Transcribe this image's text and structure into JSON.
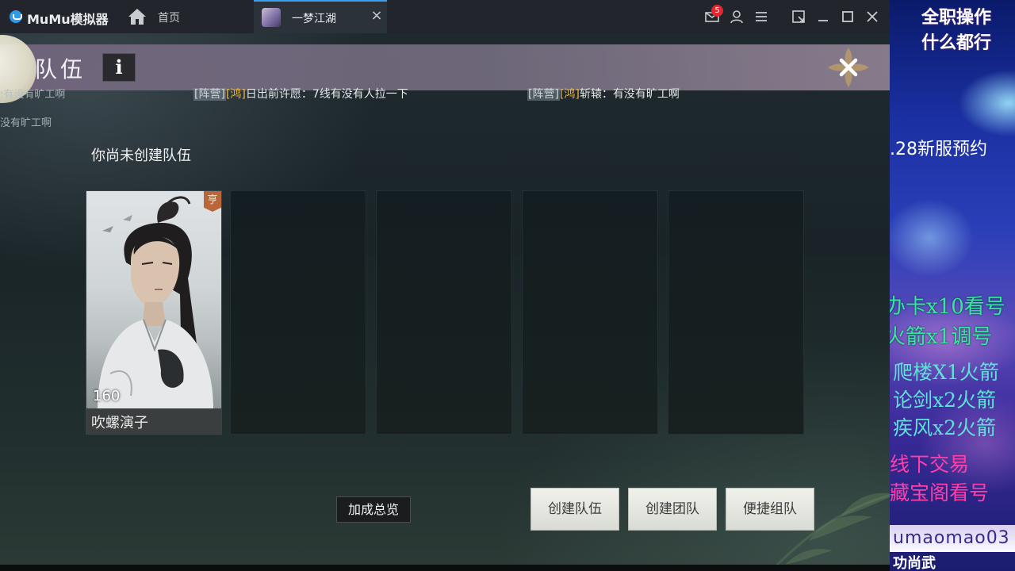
{
  "titlebar": {
    "app_name": "MuMu模拟器",
    "home_label": "首页",
    "active_tab": "一梦江湖",
    "mail_badge": "5"
  },
  "game": {
    "title": "队伍",
    "info_label": "i",
    "chat": [
      {
        "tag": "[阵营]",
        "guild": "[鸿]",
        "text": "日出前许愿：7线有没有人拉一下"
      },
      {
        "tag": "[阵营]",
        "guild": "[鸿]",
        "text": "斩辕：有没有旷工啊"
      }
    ],
    "chat_faded": [
      ":有没有旷工啊",
      "没有旷工啊"
    ],
    "no_team_text": "你尚未创建队伍",
    "member": {
      "level": "160",
      "name": "吹螺演子",
      "sect_badge": "亨"
    },
    "bonus_button": "加成总览",
    "buttons": {
      "create_team": "创建队伍",
      "create_group": "创建团队",
      "quick_match": "便捷组队"
    }
  },
  "overlay": {
    "header_line1": "全职操作",
    "header_line2": "什么都行",
    "promo": ".28新服预约",
    "lines_green": [
      "办卡x10看号",
      "火箭x1调号"
    ],
    "lines_teal": [
      "爬楼X1火箭",
      "论剑x2火箭",
      "疾风x2火箭"
    ],
    "lines_pink": [
      "线下交易",
      "藏宝阁看号"
    ],
    "username": "umaomao03",
    "bottom": "功尚武"
  },
  "colors": {
    "accent_blue": "#3aa0ee",
    "badge_red": "#e3262f",
    "guild_gold": "#e7b54a",
    "overlay_green": "#35e7a0",
    "overlay_pink": "#ff3fa8"
  }
}
